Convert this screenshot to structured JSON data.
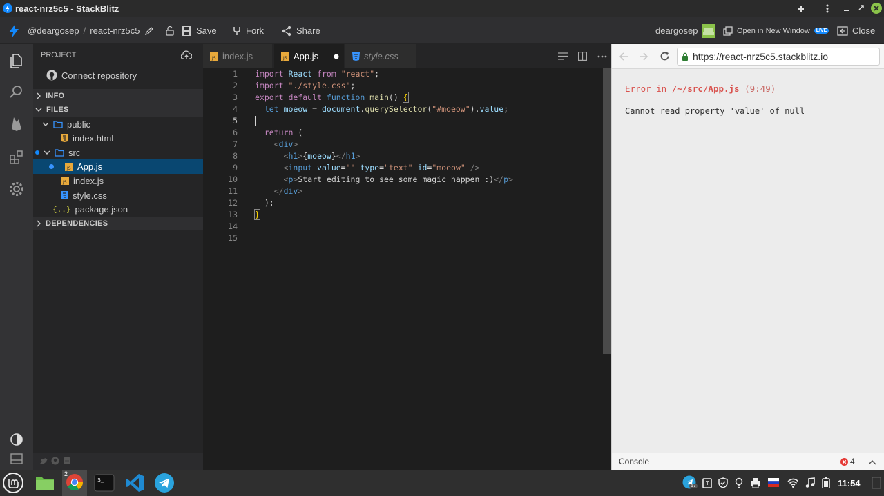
{
  "window": {
    "title": "react-nrz5c5 - StackBlitz"
  },
  "toolbar": {
    "user": "@deargosep",
    "separator": "/",
    "project": "react-nrz5c5",
    "save": "Save",
    "fork": "Fork",
    "share": "Share",
    "username": "deargosep",
    "open_new_window": "Open in New Window",
    "live_badge": "LIVE",
    "close": "Close"
  },
  "sidebar": {
    "project_header": "PROJECT",
    "connect_repo": "Connect repository",
    "info": "INFO",
    "files": "FILES",
    "tree": {
      "public": "public",
      "index_html": "index.html",
      "src": "src",
      "app_js": "App.js",
      "index_js": "index.js",
      "style_css": "style.css",
      "package_json": "package.json"
    },
    "dependencies": "DEPENDENCIES",
    "json_glyph": "{..}"
  },
  "tabs": [
    {
      "label": "index.js"
    },
    {
      "label": "App.js"
    },
    {
      "label": "style.css"
    }
  ],
  "editor": {
    "line_numbers": [
      "1",
      "2",
      "3",
      "4",
      "5",
      "6",
      "7",
      "8",
      "9",
      "10",
      "11",
      "12",
      "13",
      "14",
      "15"
    ]
  },
  "preview": {
    "url": "https://react-nrz5c5.stackblitz.io",
    "error_prefix": "Error in ",
    "error_path": "/~/src/App.js",
    "error_pos": " (9:49)",
    "error_message": "Cannot read property 'value' of null",
    "console_label": "Console",
    "error_count": "4"
  },
  "taskbar": {
    "chrome_badge": "2",
    "telegram_badge": "57",
    "clock": "11:54"
  },
  "colors": {
    "accent": "#1389fd",
    "selection": "#094771",
    "error": "#d9534f"
  }
}
